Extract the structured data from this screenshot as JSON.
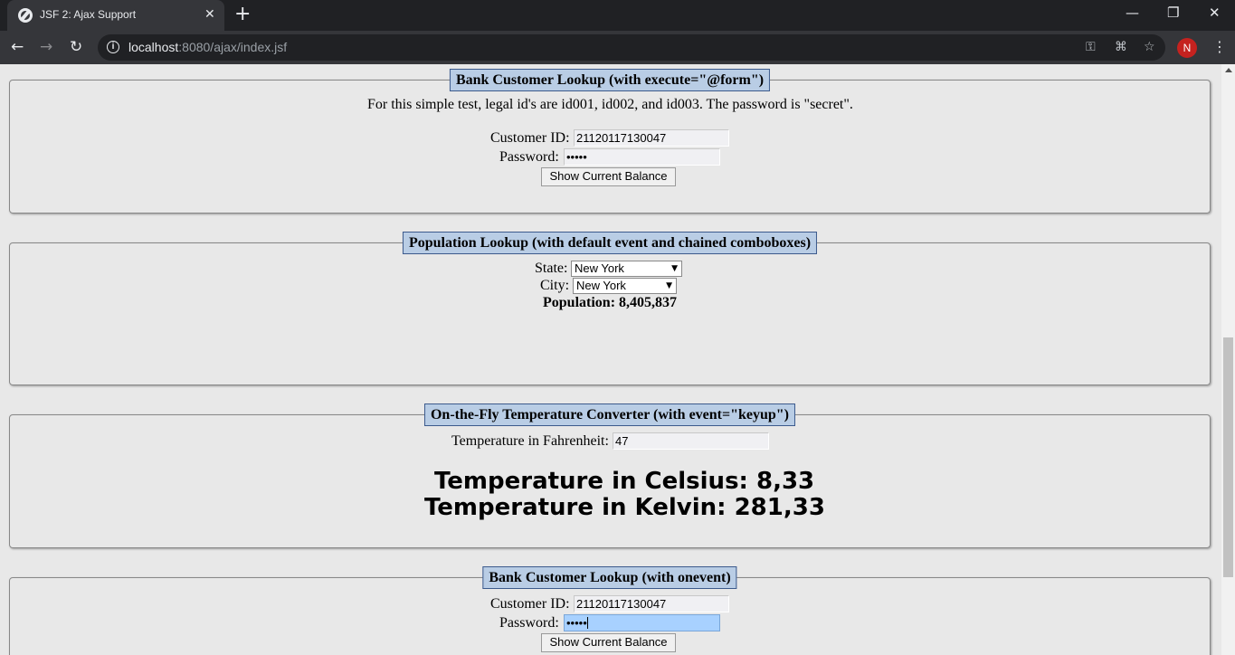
{
  "browser": {
    "tab_title": "JSF 2: Ajax Support",
    "tab_close": "✕",
    "new_tab": "+",
    "window_minimize": "—",
    "window_restore": "❐",
    "window_close": "✕",
    "nav_back": "←",
    "nav_forward": "→",
    "nav_reload": "↻",
    "info_icon": "i",
    "url_host": "localhost",
    "url_rest": ":8080/ajax/index.jsf",
    "key_icon": "⚿",
    "translate_icon": "⌘",
    "star_icon": "☆",
    "profile_initial": "N",
    "menu_icon": "⋮"
  },
  "panel1": {
    "legend": "Bank Customer Lookup (with execute=\"@form\")",
    "instructions": "For this simple test, legal id's are id001, id002, and id003. The password is \"secret\".",
    "customer_id_label": "Customer ID:",
    "customer_id_value": "21120117130047",
    "password_label": "Password:",
    "password_value": "•••••",
    "button_label": "Show Current Balance"
  },
  "panel2": {
    "legend": "Population Lookup (with default event and chained comboboxes)",
    "state_label": "State:",
    "state_value": "New York",
    "city_label": "City:",
    "city_value": "New York",
    "population_text": "Population: 8,405,837",
    "dropdown_arrow": "▼"
  },
  "panel3": {
    "legend": "On-the-Fly Temperature Converter (with event=\"keyup\")",
    "fahrenheit_label": "Temperature in Fahrenheit:",
    "fahrenheit_value": "47",
    "celsius_text": "Temperature in Celsius: 8,33",
    "kelvin_text": "Temperature in Kelvin: 281,33"
  },
  "panel4": {
    "legend": "Bank Customer Lookup (with onevent)",
    "customer_id_label": "Customer ID:",
    "customer_id_value": "21120117130047",
    "password_label": "Password:",
    "password_value": "•••••",
    "button_label": "Show Current Balance"
  }
}
